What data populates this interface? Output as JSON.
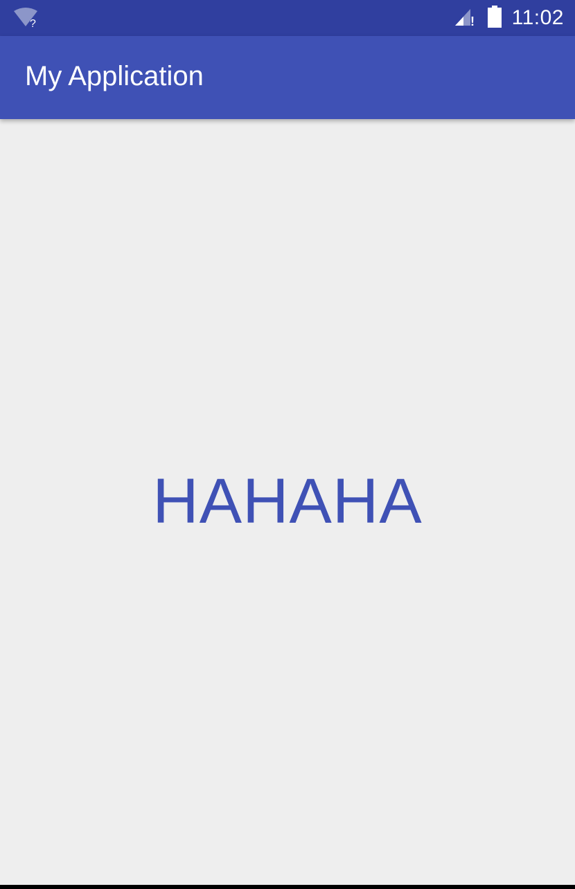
{
  "status_bar": {
    "time": "11:02",
    "wifi_badge": "?",
    "signal_badge": "!",
    "icons": [
      "wifi-no-internet-icon",
      "cell-signal-icon",
      "battery-icon"
    ]
  },
  "app_bar": {
    "title": "My Application"
  },
  "main": {
    "text": "HAHAHA"
  },
  "colors": {
    "primary": "#3f51b5",
    "primary_dark": "#303f9f",
    "background": "#eeeeee",
    "text_on_primary": "#ffffff"
  }
}
